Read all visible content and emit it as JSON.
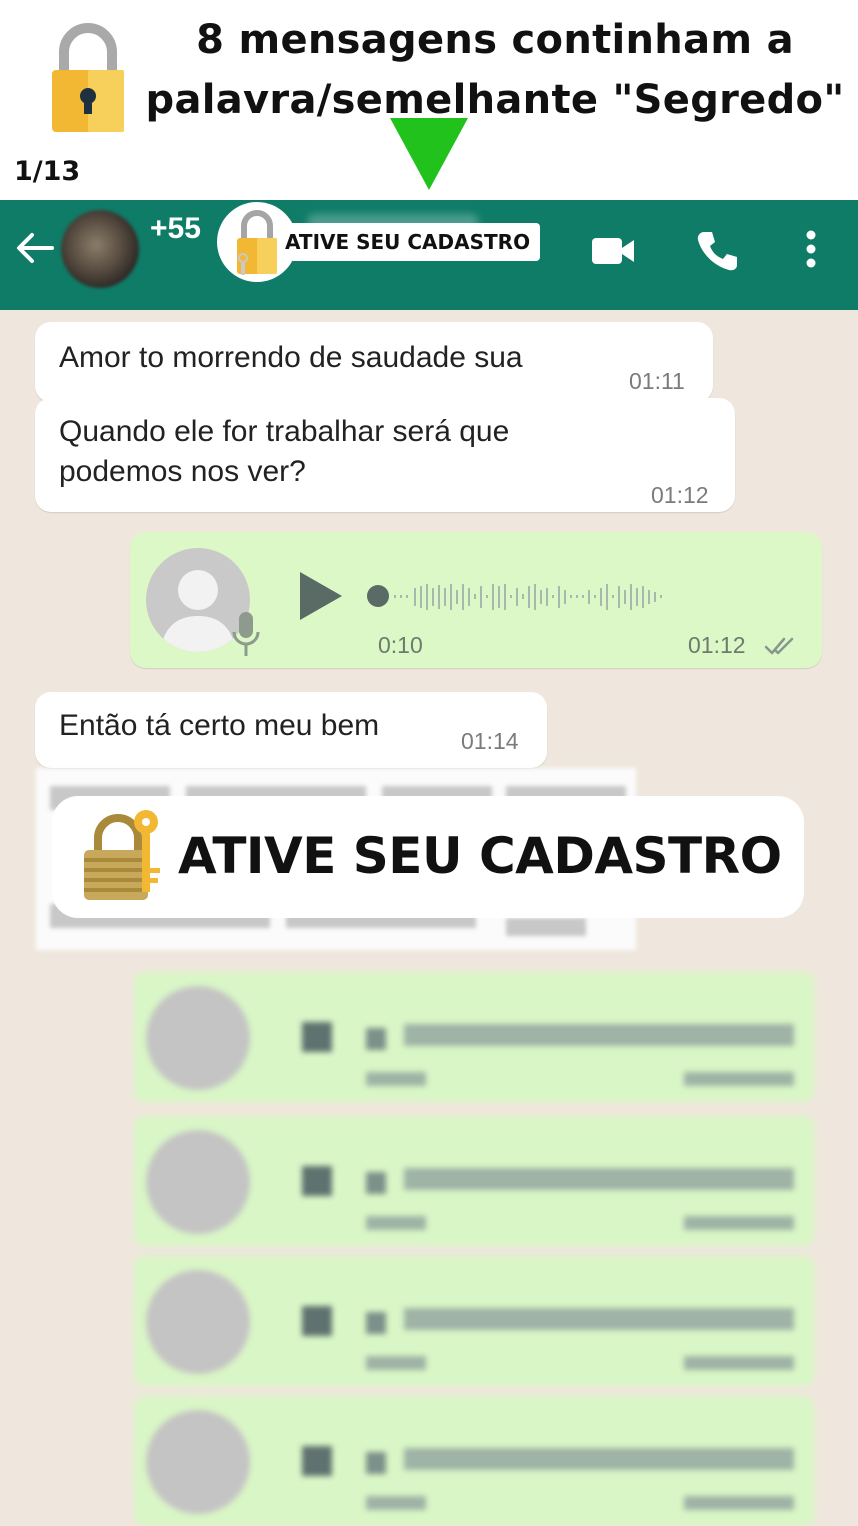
{
  "promo": {
    "title": "8 mensagens continham a palavra/semelhante \"Segredo\"",
    "counter": "1/13",
    "arrow_color": "#22c21c"
  },
  "header": {
    "phone_prefix": "+55",
    "badge_label": "ATIVE SEU CADASTRO",
    "bg_color": "#0f7c68",
    "icons": [
      "back-arrow-icon",
      "video-call-icon",
      "phone-icon",
      "more-vert-icon"
    ]
  },
  "messages": [
    {
      "type": "incoming",
      "text": "Amor to morrendo de saudade sua",
      "time": "01:11"
    },
    {
      "type": "incoming",
      "text": "Quando ele for trabalhar será que podemos nos ver?",
      "line1": "Quando ele for trabalhar será que",
      "line2": "podemos nos ver?",
      "time": "01:12"
    },
    {
      "type": "outgoing-voice",
      "duration": "0:10",
      "time": "01:12",
      "status": "read"
    },
    {
      "type": "incoming",
      "text": "Então tá certo meu bem",
      "time": "01:14"
    }
  ],
  "overlay": {
    "label": "ATIVE SEU CADASTRO"
  },
  "blurred_voice_count": 4
}
